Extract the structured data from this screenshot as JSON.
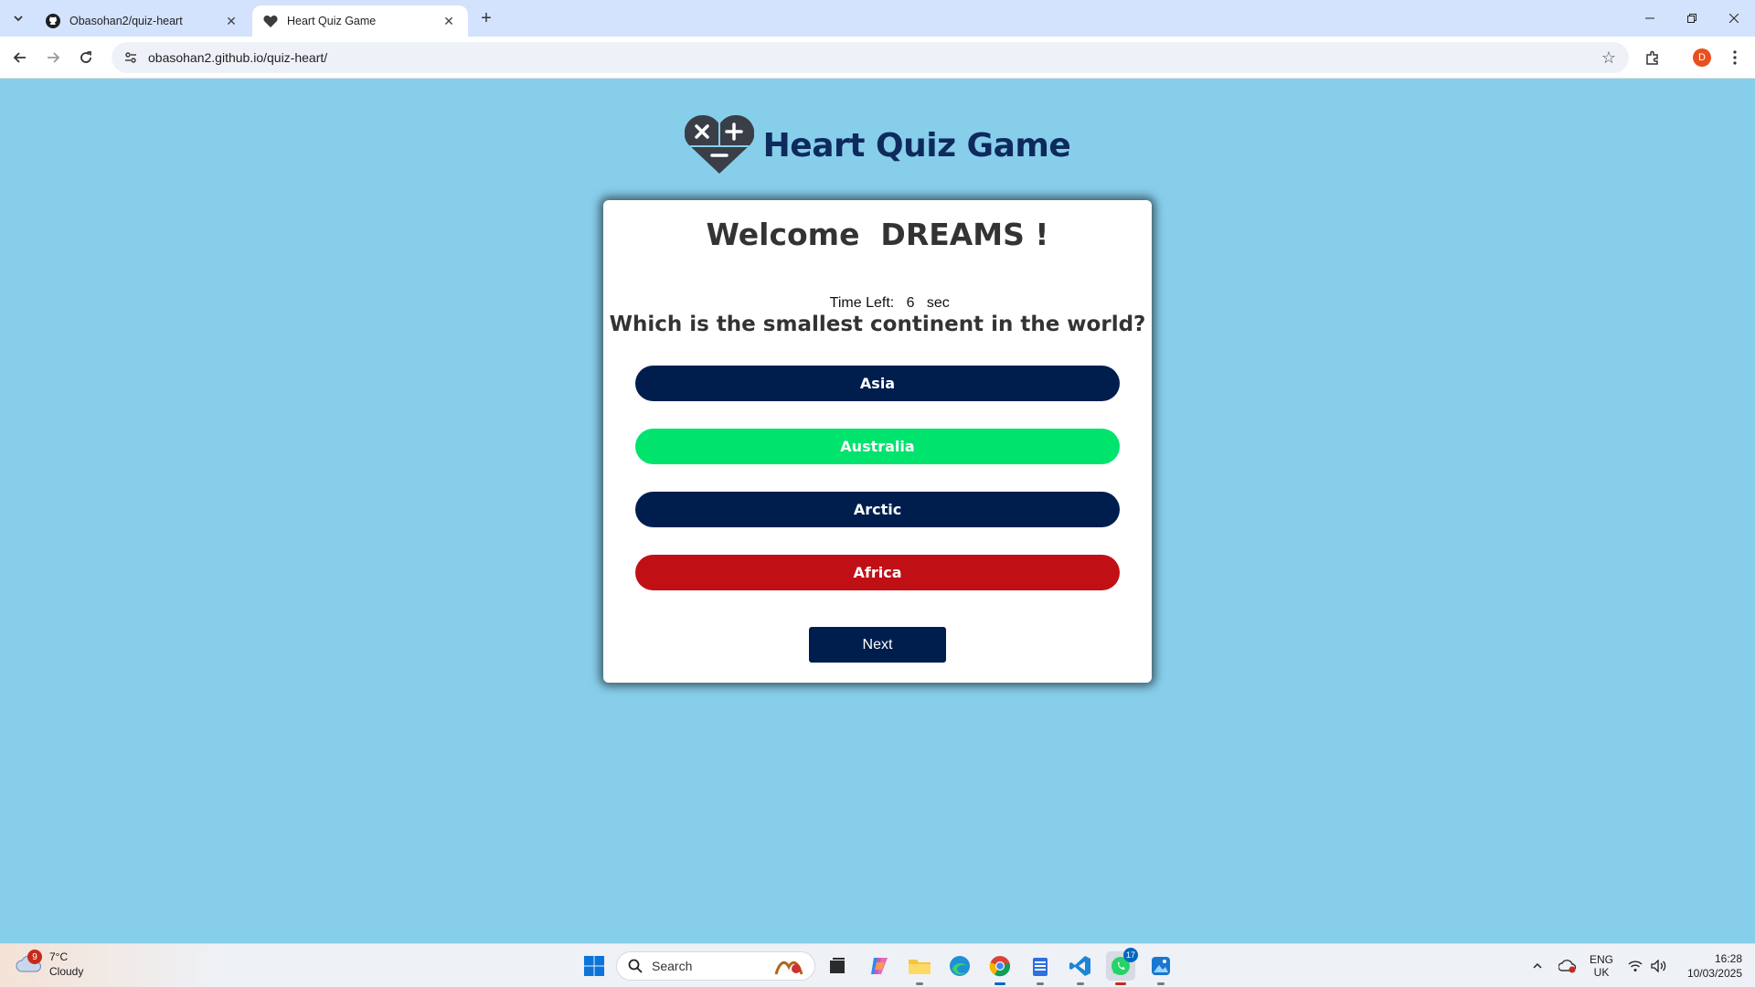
{
  "browser": {
    "tabs": [
      {
        "title": "Obasohan2/quiz-heart",
        "icon": "github-icon",
        "active": false
      },
      {
        "title": "Heart Quiz Game",
        "icon": "heart-icon",
        "active": true
      }
    ],
    "url": "obasohan2.github.io/quiz-heart/",
    "profile_initial": "D"
  },
  "page": {
    "title": "Heart Quiz Game",
    "welcome": "Welcome  DREAMS !",
    "timer": {
      "label": "Time Left:",
      "value": "6",
      "unit": "sec"
    },
    "question": "Which is the smallest continent in the world?",
    "answers": [
      {
        "label": "Asia",
        "state": "neutral",
        "color": "#001e4d"
      },
      {
        "label": "Australia",
        "state": "correct",
        "color": "#00e36d"
      },
      {
        "label": "Arctic",
        "state": "neutral",
        "color": "#001e4d"
      },
      {
        "label": "Africa",
        "state": "incorrect",
        "color": "#c01016"
      }
    ],
    "next_label": "Next"
  },
  "taskbar": {
    "weather": {
      "temp": "7°C",
      "condition": "Cloudy",
      "badge": "9"
    },
    "search_label": "Search",
    "whatsapp_badge": "17",
    "language": {
      "line1": "ENG",
      "line2": "UK"
    },
    "time": "16:28",
    "date": "10/03/2025"
  }
}
